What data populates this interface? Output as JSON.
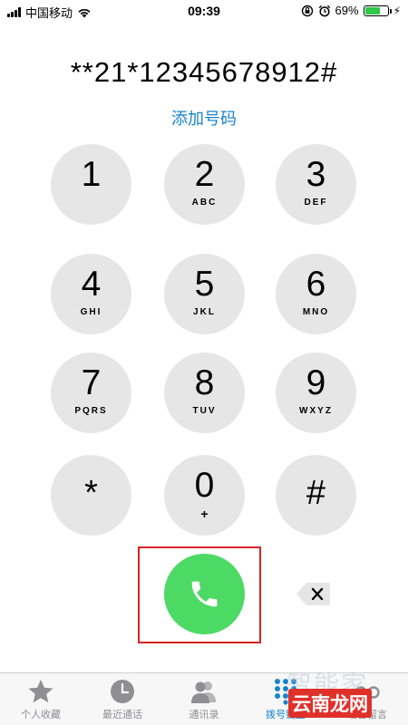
{
  "status_bar": {
    "carrier": "中国移动",
    "time": "09:39",
    "battery_percent": "69%",
    "battery_level": 0.69,
    "battery_color": "#2ec84b"
  },
  "dialer": {
    "number": "**21*12345678912#",
    "add_number_label": "添加号码"
  },
  "keypad": {
    "keys": [
      {
        "digit": "1",
        "letters": ""
      },
      {
        "digit": "2",
        "letters": "ABC"
      },
      {
        "digit": "3",
        "letters": "DEF"
      },
      {
        "digit": "4",
        "letters": "GHI"
      },
      {
        "digit": "5",
        "letters": "JKL"
      },
      {
        "digit": "6",
        "letters": "MNO"
      },
      {
        "digit": "7",
        "letters": "PQRS"
      },
      {
        "digit": "8",
        "letters": "TUV"
      },
      {
        "digit": "9",
        "letters": "WXYZ"
      },
      {
        "digit": "*",
        "letters": ""
      },
      {
        "digit": "0",
        "letters": "+"
      },
      {
        "digit": "#",
        "letters": ""
      }
    ]
  },
  "call": {
    "icon": "phone-icon",
    "color": "#4cd964",
    "highlight_color": "#d62424"
  },
  "delete": {
    "icon": "backspace-icon"
  },
  "tabs": [
    {
      "label": "个人收藏",
      "icon": "star-icon"
    },
    {
      "label": "最近通话",
      "icon": "clock-icon"
    },
    {
      "label": "通讯录",
      "icon": "contacts-icon"
    },
    {
      "label": "拨号键盘",
      "icon": "keypad-icon",
      "active": true
    },
    {
      "label": "语音留言",
      "icon": "voicemail-icon"
    }
  ],
  "accent_color": "#1a82cf",
  "watermark": {
    "text": "智能家",
    "logo": "云南龙网"
  }
}
